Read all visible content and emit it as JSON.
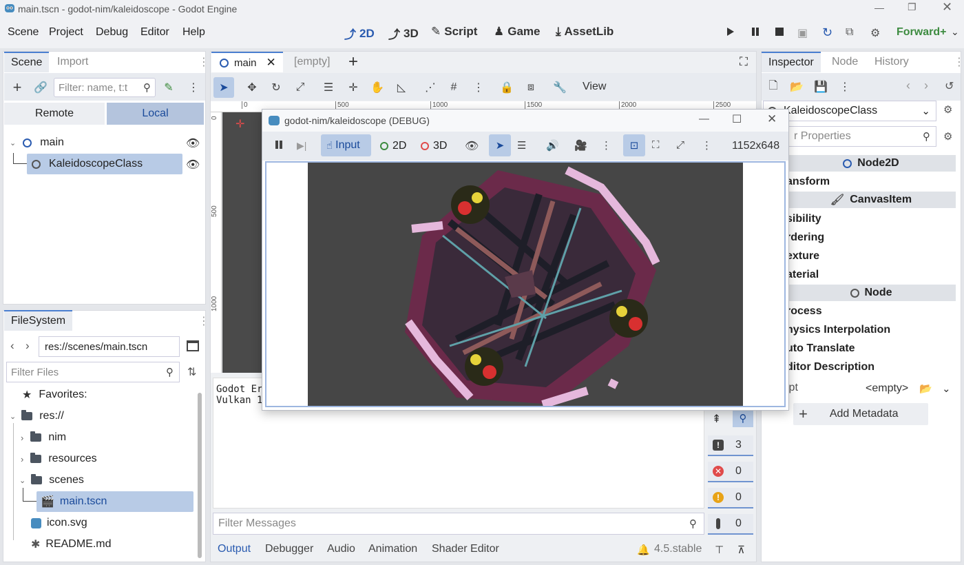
{
  "window": {
    "title": "main.tscn - godot-nim/kaleidoscope - Godot Engine"
  },
  "menu": [
    "Scene",
    "Project",
    "Debug",
    "Editor",
    "Help"
  ],
  "workspaces": [
    "2D",
    "3D",
    "Script",
    "Game",
    "AssetLib"
  ],
  "renderer": "Forward+",
  "scene_dock": {
    "tabs": [
      "Scene",
      "Import"
    ],
    "filter_placeholder": "Filter: name, t:t",
    "remote_label": "Remote",
    "local_label": "Local",
    "nodes": [
      "main",
      "KaleidoscopeClass"
    ]
  },
  "filesystem": {
    "title": "FileSystem",
    "path": "res://scenes/main.tscn",
    "filter_placeholder": "Filter Files",
    "items": [
      "Favorites:",
      "res://",
      "nim",
      "resources",
      "scenes",
      "main.tscn",
      "icon.svg",
      "README.md"
    ]
  },
  "editor_tabs": [
    "main",
    "[empty]"
  ],
  "view_label": "View",
  "rulers": [
    "0",
    "500",
    "1000",
    "1500",
    "2000",
    "2500"
  ],
  "vrulers": [
    "0",
    "500",
    "1000"
  ],
  "output": {
    "lines": [
      "Godot Er",
      "Vulkan 1"
    ],
    "filter_placeholder": "Filter Messages",
    "counts": [
      "3",
      "0",
      "0",
      "0"
    ],
    "bottom_tabs": [
      "Output",
      "Debugger",
      "Audio",
      "Animation",
      "Shader Editor"
    ],
    "version": "4.5.stable"
  },
  "inspector": {
    "tabs": [
      "Inspector",
      "Node",
      "History"
    ],
    "object": "KaleidoscopeClass",
    "filter_placeholder": "r Properties",
    "sections": [
      "Node2D",
      "CanvasItem",
      "Node"
    ],
    "node2d_props": [
      "ansform"
    ],
    "canvas_props": [
      "sibility",
      "rdering",
      "exture",
      "aterial"
    ],
    "node_props": [
      "rocess",
      "hysics Interpolation",
      "uto Translate",
      "ditor Description"
    ],
    "script_label": "ipt",
    "script_value": "<empty>",
    "add_metadata": "Add Metadata"
  },
  "debug_window": {
    "title": "godot-nim/kaleidoscope (DEBUG)",
    "input_label": "Input",
    "mode_2d": "2D",
    "mode_3d": "3D",
    "resolution": "1152x648"
  },
  "colors": {
    "accent": "#4a7fd0",
    "selection": "#b8cbe6",
    "viewport_bg": "#4a4a4a",
    "error": "#e04b4b",
    "warning": "#e8a317"
  }
}
